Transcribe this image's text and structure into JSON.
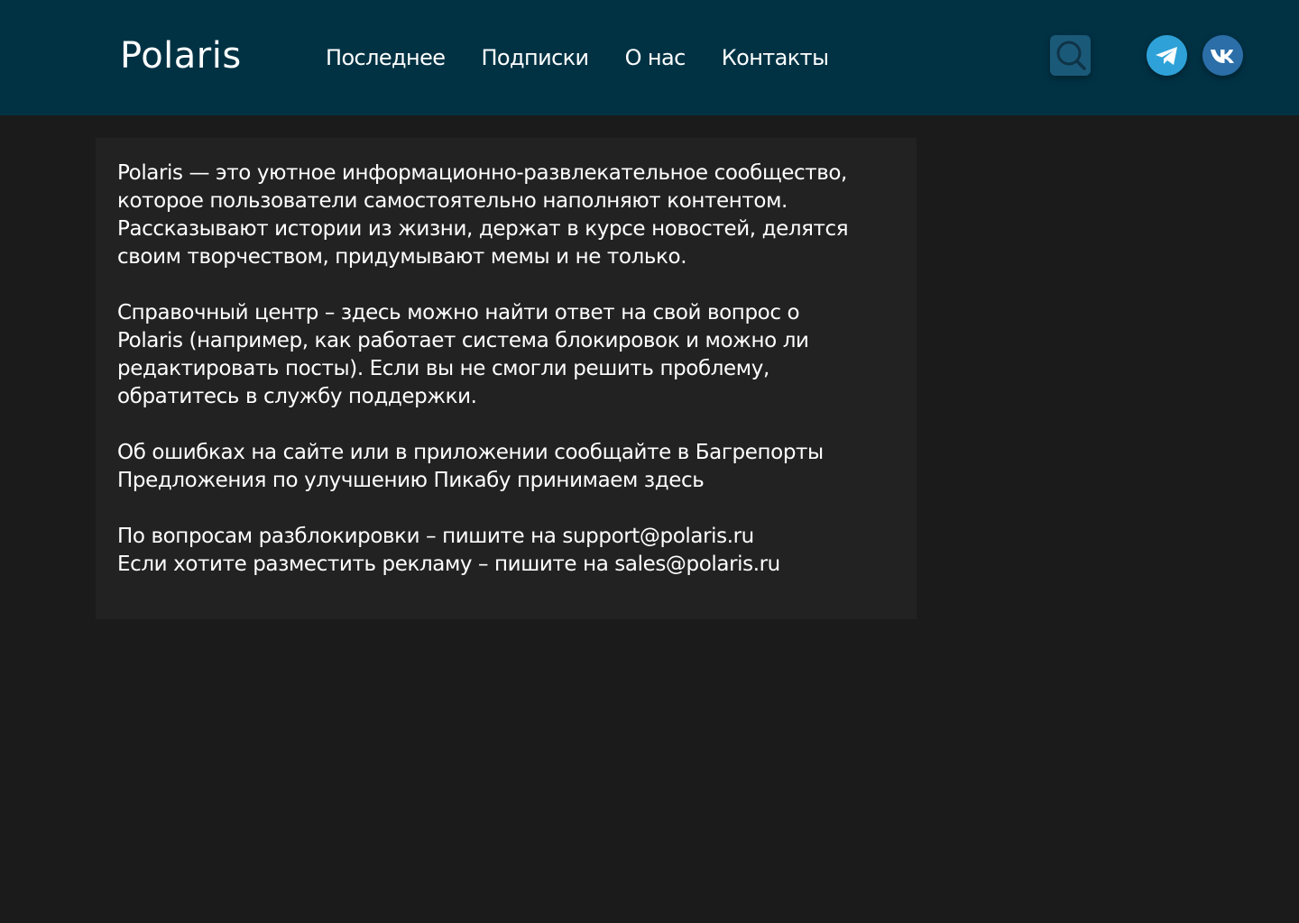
{
  "header": {
    "logo": "Polaris",
    "nav": [
      {
        "label": "Последнее"
      },
      {
        "label": "Подписки"
      },
      {
        "label": "О нас"
      },
      {
        "label": "Контакты"
      }
    ],
    "icons": {
      "search": "search-icon",
      "telegram": "telegram-icon",
      "vk": "vk-icon"
    }
  },
  "colors": {
    "header_bg": "#003244",
    "page_bg": "#1b1b1b",
    "card_bg": "#222222",
    "search_bg": "#1a5a78",
    "telegram": "#2ea2d8",
    "vk": "#2b6ea8"
  },
  "about": {
    "intro": [
      "Polaris — это уютное информационно-развлекательное сообщество,",
      "которое пользователи самостоятельно наполняют контентом.",
      "Рассказывают истории из жизни, держат в курсе новостей, делятся",
      "своим творчеством, придумывают мемы и не только."
    ],
    "help": [
      "Справочный центр – здесь можно найти ответ на свой вопрос о",
      "Polaris (например, как работает система блокировок и можно ли",
      "редактировать посты). Если вы не смогли решить проблему,",
      "обратитесь в службу поддержки."
    ],
    "feedback": [
      "Об ошибках на сайте или в приложении сообщайте в Багрепорты",
      "Предложения по улучшению Пикабу принимаем здесь"
    ],
    "contacts": [
      "По вопросам разблокировки – пишите на support@polaris.ru",
      "Если хотите разместить рекламу – пишите на sales@polaris.ru"
    ]
  }
}
